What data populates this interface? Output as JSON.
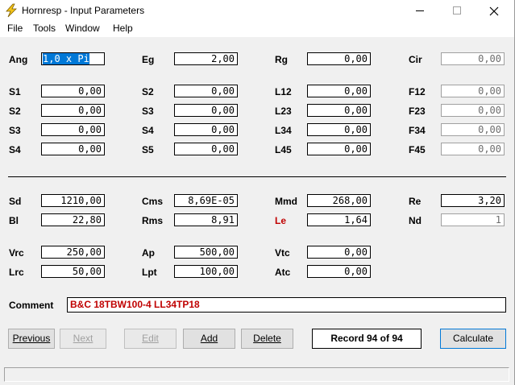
{
  "window": {
    "title": "Hornresp - Input Parameters"
  },
  "menu": {
    "file": "File",
    "tools": "Tools",
    "window": "Window",
    "help": "Help"
  },
  "params": {
    "ang": {
      "label": "Ang",
      "value": "1,0 x Pi"
    },
    "eg": {
      "label": "Eg",
      "value": "2,00"
    },
    "rg": {
      "label": "Rg",
      "value": "0,00"
    },
    "cir": {
      "label": "Cir",
      "value": "0,00"
    },
    "s1a": {
      "label": "S1",
      "value": "0,00"
    },
    "s2b": {
      "label": "S2",
      "value": "0,00"
    },
    "l12": {
      "label": "L12",
      "value": "0,00"
    },
    "f12": {
      "label": "F12",
      "value": "0,00"
    },
    "s2a": {
      "label": "S2",
      "value": "0,00"
    },
    "s3b": {
      "label": "S3",
      "value": "0,00"
    },
    "l23": {
      "label": "L23",
      "value": "0,00"
    },
    "f23": {
      "label": "F23",
      "value": "0,00"
    },
    "s3a": {
      "label": "S3",
      "value": "0,00"
    },
    "s4b": {
      "label": "S4",
      "value": "0,00"
    },
    "l34": {
      "label": "L34",
      "value": "0,00"
    },
    "f34": {
      "label": "F34",
      "value": "0,00"
    },
    "s4a": {
      "label": "S4",
      "value": "0,00"
    },
    "s5b": {
      "label": "S5",
      "value": "0,00"
    },
    "l45": {
      "label": "L45",
      "value": "0,00"
    },
    "f45": {
      "label": "F45",
      "value": "0,00"
    },
    "sd": {
      "label": "Sd",
      "value": "1210,00"
    },
    "cms": {
      "label": "Cms",
      "value": "8,69E-05"
    },
    "mmd": {
      "label": "Mmd",
      "value": "268,00"
    },
    "re": {
      "label": "Re",
      "value": "3,20"
    },
    "bl": {
      "label": "Bl",
      "value": "22,80"
    },
    "rms": {
      "label": "Rms",
      "value": "8,91"
    },
    "le": {
      "label": "Le",
      "value": "1,64"
    },
    "nd": {
      "label": "Nd",
      "value": "1"
    },
    "vrc": {
      "label": "Vrc",
      "value": "250,00"
    },
    "ap": {
      "label": "Ap",
      "value": "500,00"
    },
    "vtc": {
      "label": "Vtc",
      "value": "0,00"
    },
    "lrc": {
      "label": "Lrc",
      "value": "50,00"
    },
    "lpt": {
      "label": "Lpt",
      "value": "100,00"
    },
    "atc": {
      "label": "Atc",
      "value": "0,00"
    }
  },
  "comment": {
    "label": "Comment",
    "value": "B&C 18TBW100-4 LL34TP18"
  },
  "buttons": {
    "previous": "Previous",
    "next": "Next",
    "edit": "Edit",
    "add": "Add",
    "delete": "Delete",
    "calculate": "Calculate"
  },
  "record": "Record 94 of 94",
  "colors": {
    "accent": "#0078d7",
    "highlight_label": "#c00000",
    "comment_text": "#c00000",
    "icon": "#f5c518"
  },
  "icons": {
    "app": "lightning-bolt-icon",
    "minimize": "minimize-icon",
    "maximize": "maximize-icon",
    "close": "close-icon"
  }
}
